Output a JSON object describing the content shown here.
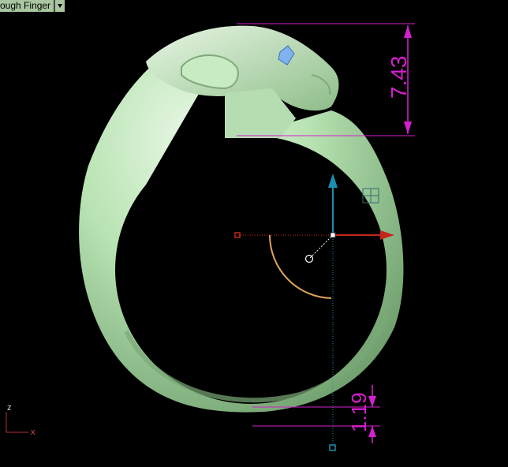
{
  "viewport": {
    "object_tag": "ough Finger",
    "dims": {
      "top": "7.43",
      "bottom": "1.19"
    },
    "axes": {
      "z": "z",
      "x": "x"
    },
    "colors": {
      "background": "#000000",
      "ring": "#a8d6a4",
      "dimension": "#d61fcf",
      "gumball_x": "#c3271b",
      "gumball_z": "#1a8fae",
      "arc": "#e0a35b",
      "gem": "#7fb3f0"
    },
    "icons": [
      "ring-model",
      "dimension-lines",
      "gumball-widget",
      "axis-triad",
      "dropdown-arrow"
    ]
  }
}
